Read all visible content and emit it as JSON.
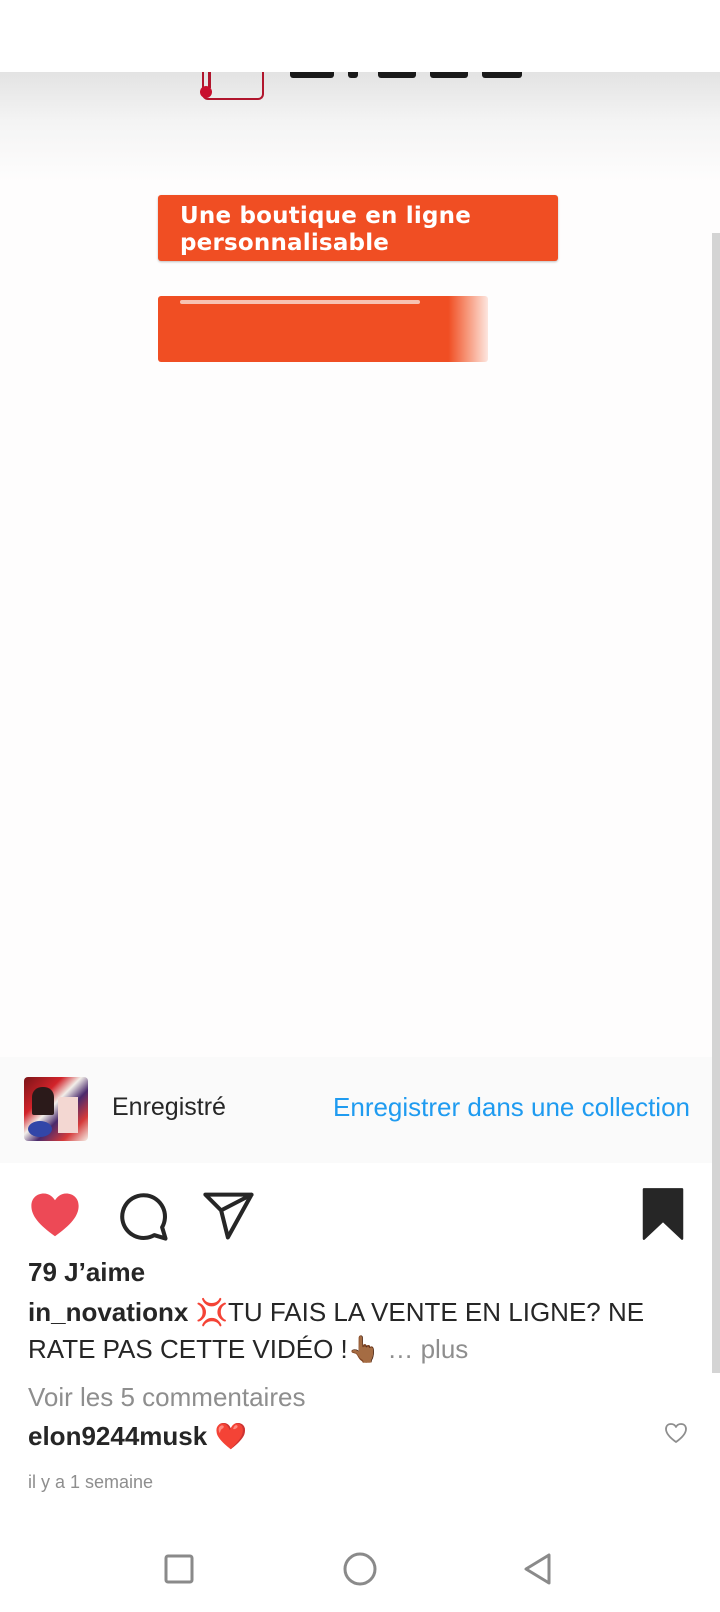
{
  "media": {
    "banner_line1": "Une boutique en ligne",
    "banner_line2": "personnalisable",
    "accent_color": "#f04e23"
  },
  "save_bar": {
    "status": "Enregistré",
    "collection_link": "Enregistrer dans une collection",
    "link_color": "#1f9bf0"
  },
  "actions": {
    "like_icon": "heart-filled-icon",
    "comment_icon": "comment-icon",
    "share_icon": "send-icon",
    "save_icon": "bookmark-filled-icon",
    "like_color": "#ed4956"
  },
  "post": {
    "likes": "79 J’aime",
    "caption_user": "in_novationx",
    "caption_emoji": "💢",
    "caption_text_line1": "TU FAIS LA VENTE EN LIGNE? NE",
    "caption_text_line2": "RATE PAS CETTE VIDÉO !",
    "caption_emoji2": "👆🏾",
    "caption_more": "… plus",
    "view_comments": "Voir les 5 commentaires",
    "comment_user": "elon9244musk",
    "comment_text": "❤️",
    "timestamp": "il y a 1 semaine"
  },
  "navbar": {
    "recents_icon": "square-icon",
    "home_icon": "circle-icon",
    "back_icon": "triangle-back-icon"
  }
}
